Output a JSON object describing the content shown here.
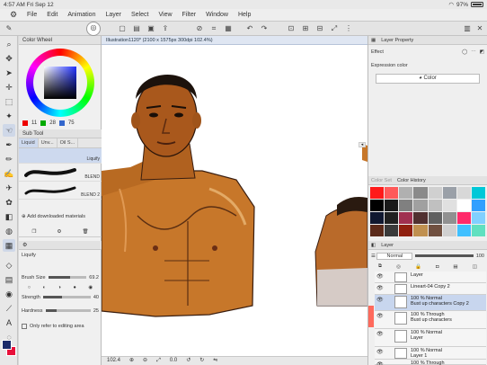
{
  "status": {
    "time": "4:57 AM",
    "date": "Fri Sep 12",
    "battery": "97%"
  },
  "menu": [
    "File",
    "Edit",
    "Animation",
    "Layer",
    "Select",
    "View",
    "Filter",
    "Window",
    "Help"
  ],
  "panels": {
    "color_wheel": {
      "title": "Color Wheel",
      "values": [
        "11",
        "28",
        "75"
      ]
    },
    "sub_tool": {
      "title": "Sub Tool",
      "tabs": [
        "Liquid",
        "Unv...",
        "Oil S..."
      ],
      "brushes": [
        "Liquify",
        "BLEND",
        "BLEND 2"
      ],
      "add_label": "Add downloaded materials"
    },
    "tool_property": {
      "name": "Liquify",
      "brush_size_label": "Brush Size",
      "brush_size": "69.2",
      "brush_size_level": 0.58,
      "strength_label": "Strength",
      "strength": "40",
      "strength_level": 0.4,
      "hardness_label": "Hardness",
      "hardness": "25",
      "hardness_level": 0.25,
      "editing_area_label": "Only refer to editing area"
    }
  },
  "document": {
    "tab_title": "Illustration1120* (2100 x 1575px 300dpi 102.4%)",
    "zoom": "102.4",
    "angle": "0.0"
  },
  "right": {
    "layer_property": {
      "title": "Layer Property",
      "effect_label": "Effect",
      "expression_label": "Expression color",
      "expression_value": "Color"
    },
    "color_history_title": "Color History",
    "color_set_title": "Color Set",
    "layer_panel": {
      "title": "Layer",
      "blend": "Normal",
      "opacity": "100",
      "layers": [
        {
          "pct": "",
          "mode": "",
          "name": "Layer",
          "selected": false
        },
        {
          "pct": "",
          "mode": "",
          "name": "Lineart-04 Copy 2",
          "selected": false
        },
        {
          "pct": "100 %",
          "mode": "Normal",
          "name": "Bust up characters Copy 2",
          "selected": true
        },
        {
          "pct": "100 %",
          "mode": "Through",
          "name": "Bust up characters",
          "selected": false
        },
        {
          "pct": "100 %",
          "mode": "Normal",
          "name": "Layer",
          "selected": false
        },
        {
          "pct": "100 %",
          "mode": "Normal",
          "name": "Layer 1",
          "selected": false
        },
        {
          "pct": "100 %",
          "mode": "Through",
          "name": "",
          "selected": false
        }
      ]
    }
  },
  "colors": {
    "accent": "#3a78d8",
    "selection": "#c8d6ee",
    "main_color": "#1a2a6a",
    "sub_color": "#e8103a",
    "palette": [
      "#ff1a1a",
      "#ff5a5a",
      "#b0b0b0",
      "#8a8a8a",
      "#d0d0d0",
      "#9aa0a8",
      "#d8d8d8",
      "#00c8d8",
      "#000000",
      "#1a1a1a",
      "#808080",
      "#a0a0a0",
      "#c0c0c0",
      "#e0e0e0",
      "#ffffff",
      "#30a0ff",
      "#101830",
      "#202020",
      "#a03050",
      "#503030",
      "#606060",
      "#909090",
      "#ff2a6a",
      "#80d0ff",
      "#5a2a1a",
      "#3a3a3a",
      "#902010",
      "#c09050",
      "#705040",
      "#d0d0d0",
      "#40c0ff",
      "#60e0c0"
    ]
  }
}
